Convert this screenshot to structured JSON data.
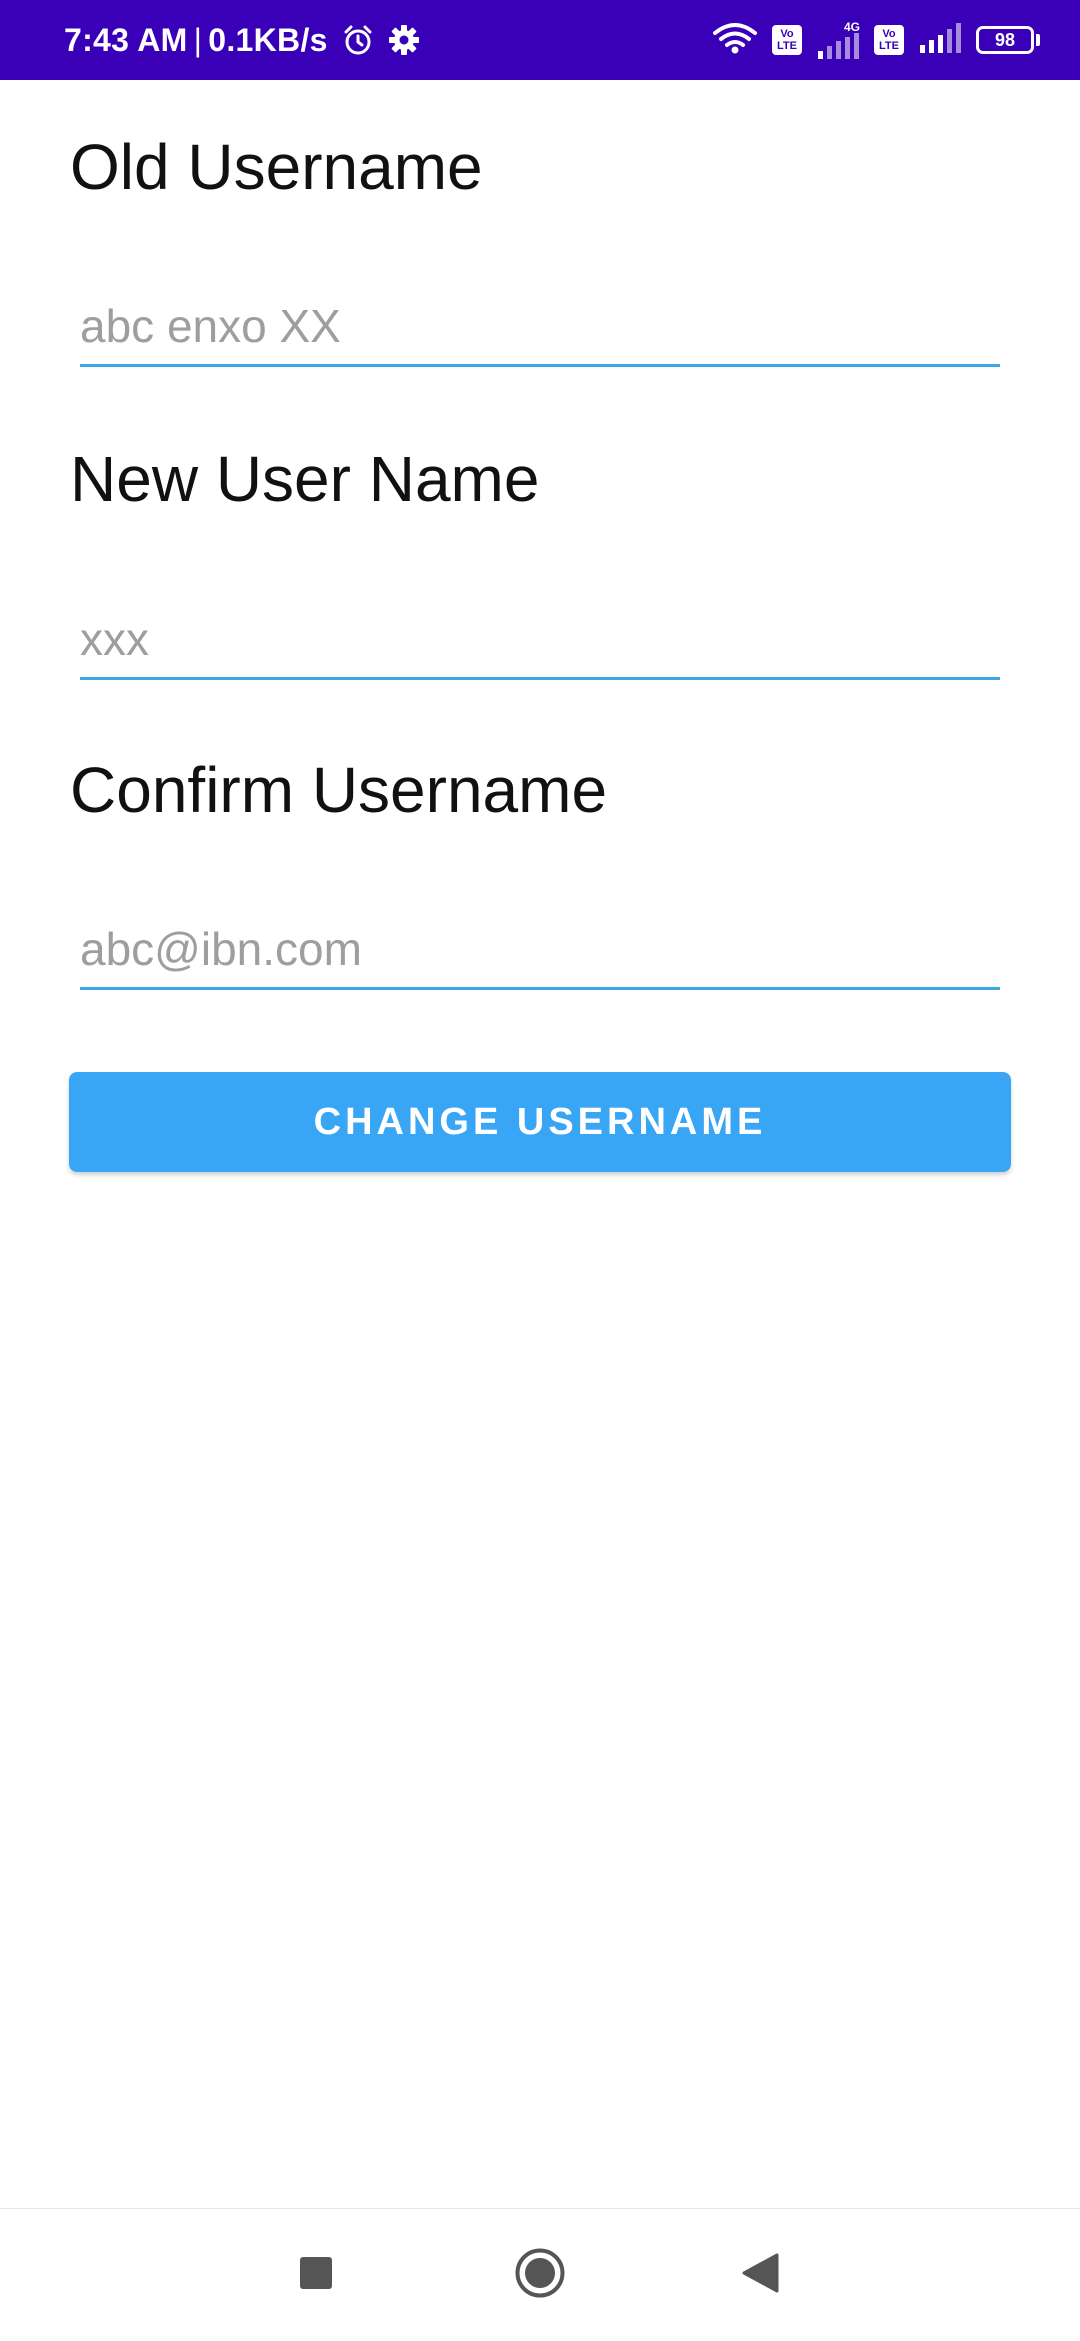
{
  "status_bar": {
    "time": "7:43 AM",
    "separator": "|",
    "network_speed": "0.1KB/s",
    "icons": [
      "alarm-icon",
      "gear-icon",
      "wifi-icon",
      "volte-icon",
      "signal-4g-icon",
      "volte-icon",
      "signal-icon",
      "battery-icon"
    ],
    "volte_label_top": "Vo",
    "volte_label_bottom": "LTE",
    "network_type": "4G",
    "battery_level": "98"
  },
  "form": {
    "old_username": {
      "label": "Old Username",
      "value": "",
      "placeholder": "abc enxo XX"
    },
    "new_username": {
      "label": "New User Name",
      "value": "",
      "placeholder": "xxx"
    },
    "confirm_username": {
      "label": "Confirm Username",
      "value": "",
      "placeholder": "abc@ibn.com"
    },
    "submit_label": "CHANGE USERNAME"
  },
  "nav_bar": {
    "icons": [
      "recents-square-icon",
      "home-circle-icon",
      "back-triangle-icon"
    ]
  },
  "colors": {
    "status_bar_bg": "#3a00b8",
    "accent": "#39a6f5",
    "underline": "#3aa7e8",
    "placeholder": "#9e9e9e"
  }
}
